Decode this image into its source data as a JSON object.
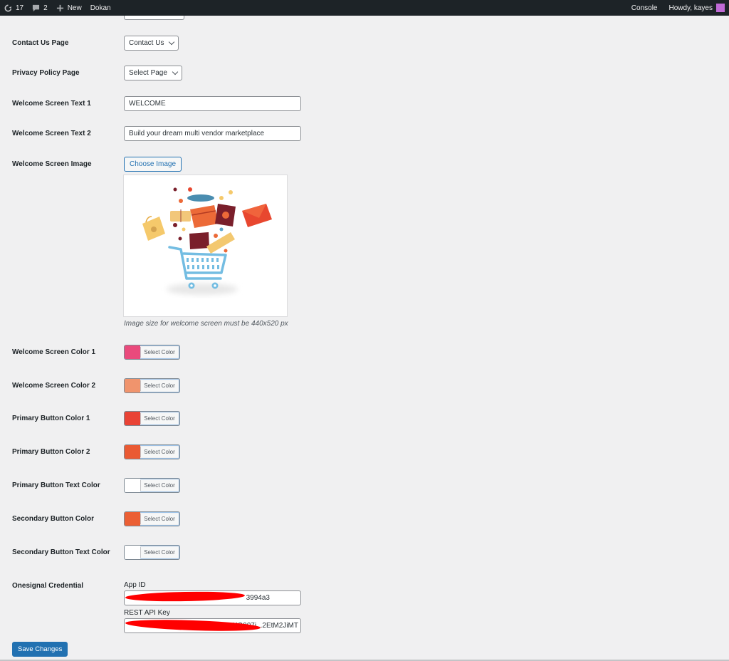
{
  "admin_bar": {
    "updates_count": "17",
    "comments_count": "2",
    "new_label": "New",
    "site_label": "Dokan",
    "console_label": "Console",
    "howdy_label": "Howdy, kayes",
    "avatar_color": "#c06ad6"
  },
  "form": {
    "contact_us_page": {
      "label": "Contact Us Page",
      "selected": "Contact Us"
    },
    "privacy_policy_page": {
      "label": "Privacy Policy Page",
      "selected": "Select Page"
    },
    "welcome_text_1": {
      "label": "Welcome Screen Text 1",
      "value": "WELCOME"
    },
    "welcome_text_2": {
      "label": "Welcome Screen Text 2",
      "value": "Build your dream multi vendor marketplace"
    },
    "welcome_image": {
      "label": "Welcome Screen Image",
      "button_label": "Choose Image",
      "help_text": "Image size for welcome screen must be 440x520 px",
      "image_alt": "shopping cart illustration"
    },
    "colors": [
      {
        "label": "Welcome Screen Color 1",
        "color": "#ea4a7c",
        "button_label": "Select Color"
      },
      {
        "label": "Welcome Screen Color 2",
        "color": "#f0946d",
        "button_label": "Select Color"
      },
      {
        "label": "Primary Button Color 1",
        "color": "#e94335",
        "button_label": "Select Color"
      },
      {
        "label": "Primary Button Color 2",
        "color": "#ea5a33",
        "button_label": "Select Color"
      },
      {
        "label": "Primary Button Text Color",
        "color": "#ffffff",
        "button_label": "Select Color"
      },
      {
        "label": "Secondary Button Color",
        "color": "#eb5f34",
        "button_label": "Select Color"
      },
      {
        "label": "Secondary Button Text Color",
        "color": "#ffffff",
        "button_label": "Select Color"
      }
    ],
    "onesignal": {
      "label": "Onesignal Credential",
      "app_id_label": "App ID",
      "app_id_value_visible": "3994a3",
      "rest_api_key_label": "REST API Key",
      "rest_api_key_visible": "YG007i...2EtM2JiMT"
    },
    "save_label": "Save Changes"
  }
}
